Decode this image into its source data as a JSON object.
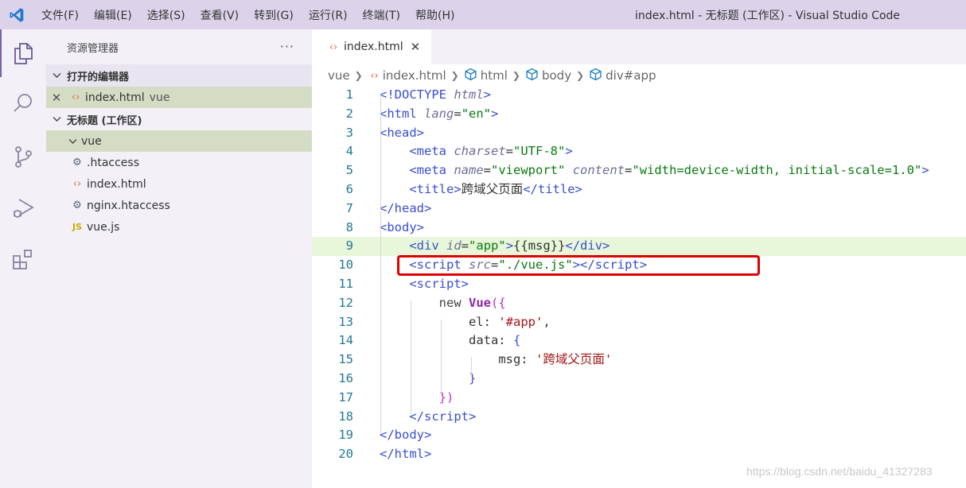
{
  "titlebar": {
    "menu": [
      "文件(F)",
      "编辑(E)",
      "选择(S)",
      "查看(V)",
      "转到(G)",
      "运行(R)",
      "终端(T)",
      "帮助(H)"
    ],
    "window_title": "index.html - 无标题 (工作区) - Visual Studio Code",
    "logo_icon": "vscode-logo-icon"
  },
  "activitybar": {
    "icons": [
      "explorer-icon",
      "search-icon",
      "source-control-icon",
      "run-debug-icon",
      "extensions-icon"
    ]
  },
  "sidebar": {
    "title": "资源管理器",
    "more": "···",
    "open_editors": {
      "label": "打开的编辑器",
      "items": [
        {
          "name": "index.html",
          "folder": "vue"
        }
      ]
    },
    "workspace": {
      "label": "无标题 (工作区)",
      "folder": "vue",
      "files": [
        {
          "name": ".htaccess",
          "icon": "gear-icon"
        },
        {
          "name": "index.html",
          "icon": "html-icon"
        },
        {
          "name": "nginx.htaccess",
          "icon": "gear-icon"
        },
        {
          "name": "vue.js",
          "icon": "js-icon"
        }
      ]
    }
  },
  "editor": {
    "tab": {
      "label": "index.html"
    },
    "breadcrumb": [
      "vue",
      "index.html",
      "html",
      "body",
      "div#app"
    ],
    "line_numbers": [
      "1",
      "2",
      "3",
      "4",
      "5",
      "6",
      "7",
      "8",
      "9",
      "10",
      "11",
      "12",
      "13",
      "14",
      "15",
      "16",
      "17",
      "18",
      "19",
      "20"
    ],
    "highlighted_line": 9,
    "annotated_line": 10
  },
  "colors": {
    "titlebar_bg": "#dcd3ea",
    "sidebar_bg": "#f3f1f7",
    "selected_row_bg": "#d5dcc4",
    "highlight_line_bg": "#e8f6d9",
    "annotation_box": "#e00000",
    "vscode_blue": "#1f7ad4"
  },
  "watermark": "https://blog.csdn.net/baidu_41327283"
}
